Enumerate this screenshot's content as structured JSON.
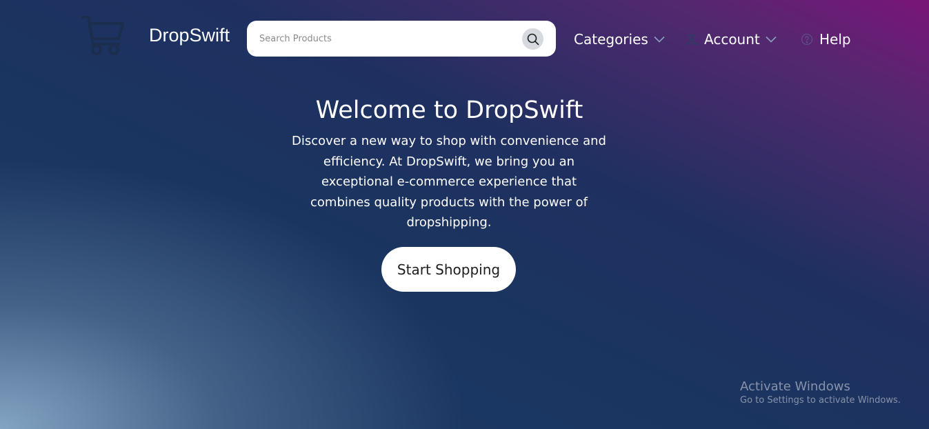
{
  "header": {
    "logo_icon": "shopping-cart-icon",
    "brand": "DropSwift",
    "search": {
      "placeholder": "Search Products",
      "value": "",
      "icon": "search-icon"
    },
    "nav": {
      "categories": {
        "label": "Categories",
        "icon": "chevron-down-icon"
      },
      "account": {
        "label": "Account",
        "icon": "user-icon",
        "chevron": "chevron-down-icon"
      },
      "help": {
        "label": "Help",
        "icon": "help-circle-icon"
      }
    }
  },
  "hero": {
    "title": "Welcome to DropSwift",
    "description": "Discover a new way to shop with convenience and efficiency. At DropSwift, we bring you an exceptional e-commerce experience that combines quality products with the power of dropshipping.",
    "cta_label": "Start Shopping"
  },
  "os_watermark": {
    "title": "Activate Windows",
    "subtitle": "Go to Settings to activate Windows."
  },
  "colors": {
    "gradient_top_right": "#7a1578",
    "gradient_mid": "#1f3060",
    "gradient_bottom_left": "#8aaac8",
    "search_button_bg": "#d6d9de",
    "cart_icon": "#1b2e4d"
  }
}
